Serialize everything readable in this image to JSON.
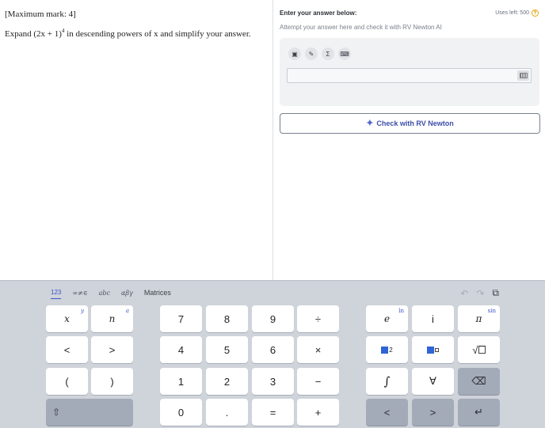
{
  "question": {
    "mark": "[Maximum mark: 4]",
    "text_before": "Expand ",
    "expression": "(2x + 1)",
    "exponent": "4",
    "text_after": " in descending powers of x and simplify your answer."
  },
  "answer": {
    "title": "Enter your answer below:",
    "uses_left": "Uses left: 500",
    "help_glyph": "?",
    "subtitle": "Attempt your answer here and check it with RV Newton AI",
    "tools": [
      {
        "icon": "image-icon",
        "glyph": "▣"
      },
      {
        "icon": "pencil-icon",
        "glyph": "✎"
      },
      {
        "icon": "sigma-icon",
        "glyph": "Σ"
      },
      {
        "icon": "keyboard-icon",
        "glyph": "⌨"
      }
    ],
    "input_value": "",
    "check_label": "Check with RV Newton",
    "check_icon": "sparkle-icon"
  },
  "keyboard": {
    "tabs": [
      "123",
      "∞≠∈",
      "abc",
      "αβγ",
      "Matrices"
    ],
    "active_tab": "123",
    "keys": {
      "x": "x",
      "x_corner": "y",
      "n": "n",
      "n_corner": "a",
      "lt": "<",
      "gt": ">",
      "lparen": "(",
      "rparen": ")",
      "k7": "7",
      "k8": "8",
      "k9": "9",
      "div": "÷",
      "k4": "4",
      "k5": "5",
      "k6": "6",
      "mul": "×",
      "k1": "1",
      "k2": "2",
      "k3": "3",
      "minus": "−",
      "k0": "0",
      "dot": ".",
      "eq": "=",
      "plus": "+",
      "e": "e",
      "e_corner": "ln",
      "i": "i",
      "pi": "π",
      "pi_corner": "sin",
      "sq_exp": "2",
      "sqrt": "√",
      "integral": "∫",
      "forall": "∀",
      "backspace": "⌫",
      "shift": "⇧",
      "left": "<",
      "right": ">",
      "enter": "↵"
    }
  },
  "colors": {
    "accent": "#3a55c8",
    "keyboard_bg": "#cfd3da",
    "dark_key": "#a4abb8"
  }
}
